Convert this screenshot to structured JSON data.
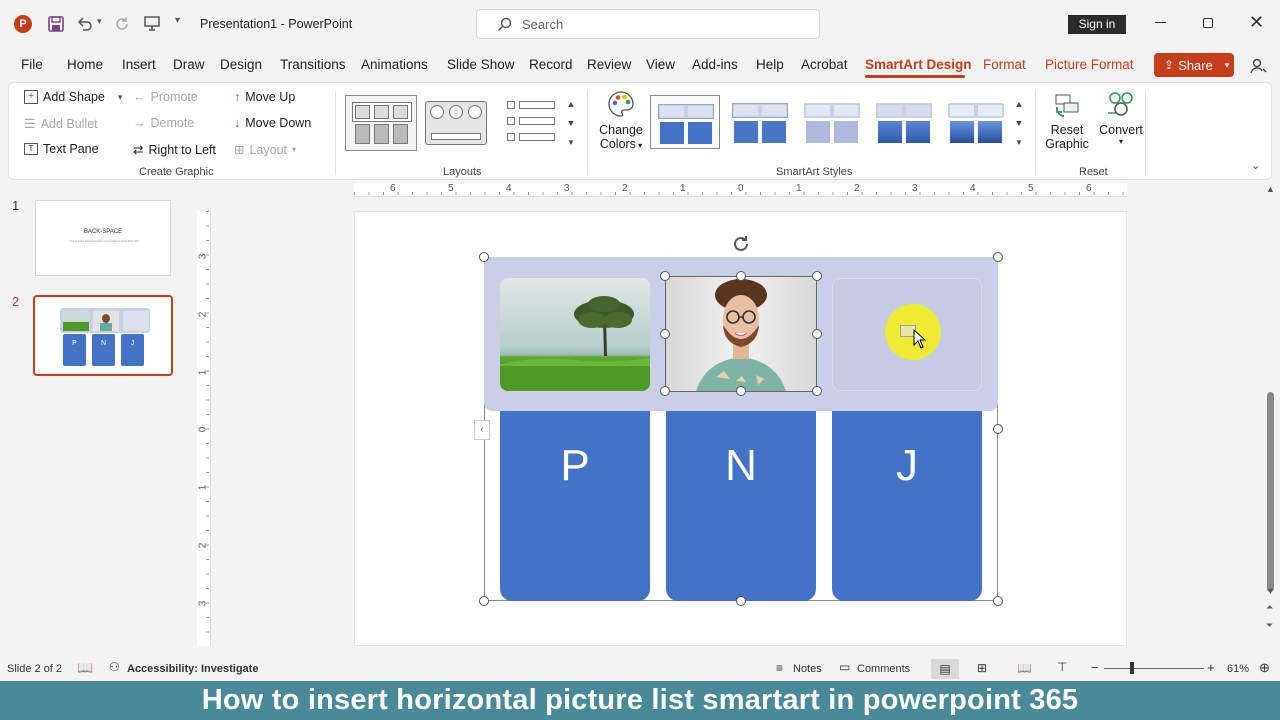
{
  "titlebar": {
    "doc_name": "Presentation1",
    "sep": " - ",
    "app_name": "PowerPoint",
    "search_placeholder": "Search",
    "sign_in": "Sign in"
  },
  "menu": {
    "file": "File",
    "home": "Home",
    "insert": "Insert",
    "draw": "Draw",
    "design": "Design",
    "transitions": "Transitions",
    "animations": "Animations",
    "slideshow": "Slide Show",
    "record": "Record",
    "review": "Review",
    "view": "View",
    "addins": "Add-ins",
    "help": "Help",
    "acrobat": "Acrobat",
    "smartart_design": "SmartArt Design",
    "format": "Format",
    "picture_format": "Picture Format",
    "share": "Share"
  },
  "ribbon": {
    "add_shape": "Add Shape",
    "add_bullet": "Add Bullet",
    "text_pane": "Text Pane",
    "promote": "Promote",
    "demote": "Demote",
    "right_to_left": "Right to Left",
    "move_up": "Move Up",
    "move_down": "Move Down",
    "layout": "Layout",
    "group_create": "Create Graphic",
    "group_layouts": "Layouts",
    "change": "Change",
    "colors": "Colors",
    "group_styles": "SmartArt Styles",
    "reset": "Reset",
    "graphic": "Graphic",
    "convert": "Convert",
    "group_reset": "Reset"
  },
  "slides": {
    "n1": "1",
    "n2": "2",
    "s1_title": "BACK-SPACE",
    "s1_sub": "How to insert horizontal picture list smartart in PowerPoint 365"
  },
  "ruler_h": [
    "6",
    "5",
    "4",
    "3",
    "2",
    "1",
    "0",
    "1",
    "2",
    "3",
    "4",
    "5",
    "6"
  ],
  "ruler_v": [
    "3",
    "2",
    "1",
    "0",
    "1",
    "2",
    "3"
  ],
  "smartart": {
    "letters": [
      "P",
      "N",
      "J"
    ]
  },
  "status": {
    "slide": "Slide 2 of 2",
    "accessibility": "Accessibility: Investigate",
    "notes": "Notes",
    "comments": "Comments",
    "zoom": "61%"
  },
  "banner": "How to insert horizontal picture list smartart in powerpoint 365",
  "colors": {
    "accent": "#c43e1c",
    "share_bg": "#c43e1c",
    "tile_blue": "#4472c4",
    "group_bg": "#c9cfe6",
    "banner_bg": "#4a8a98",
    "pointer": "#f3f01a"
  }
}
